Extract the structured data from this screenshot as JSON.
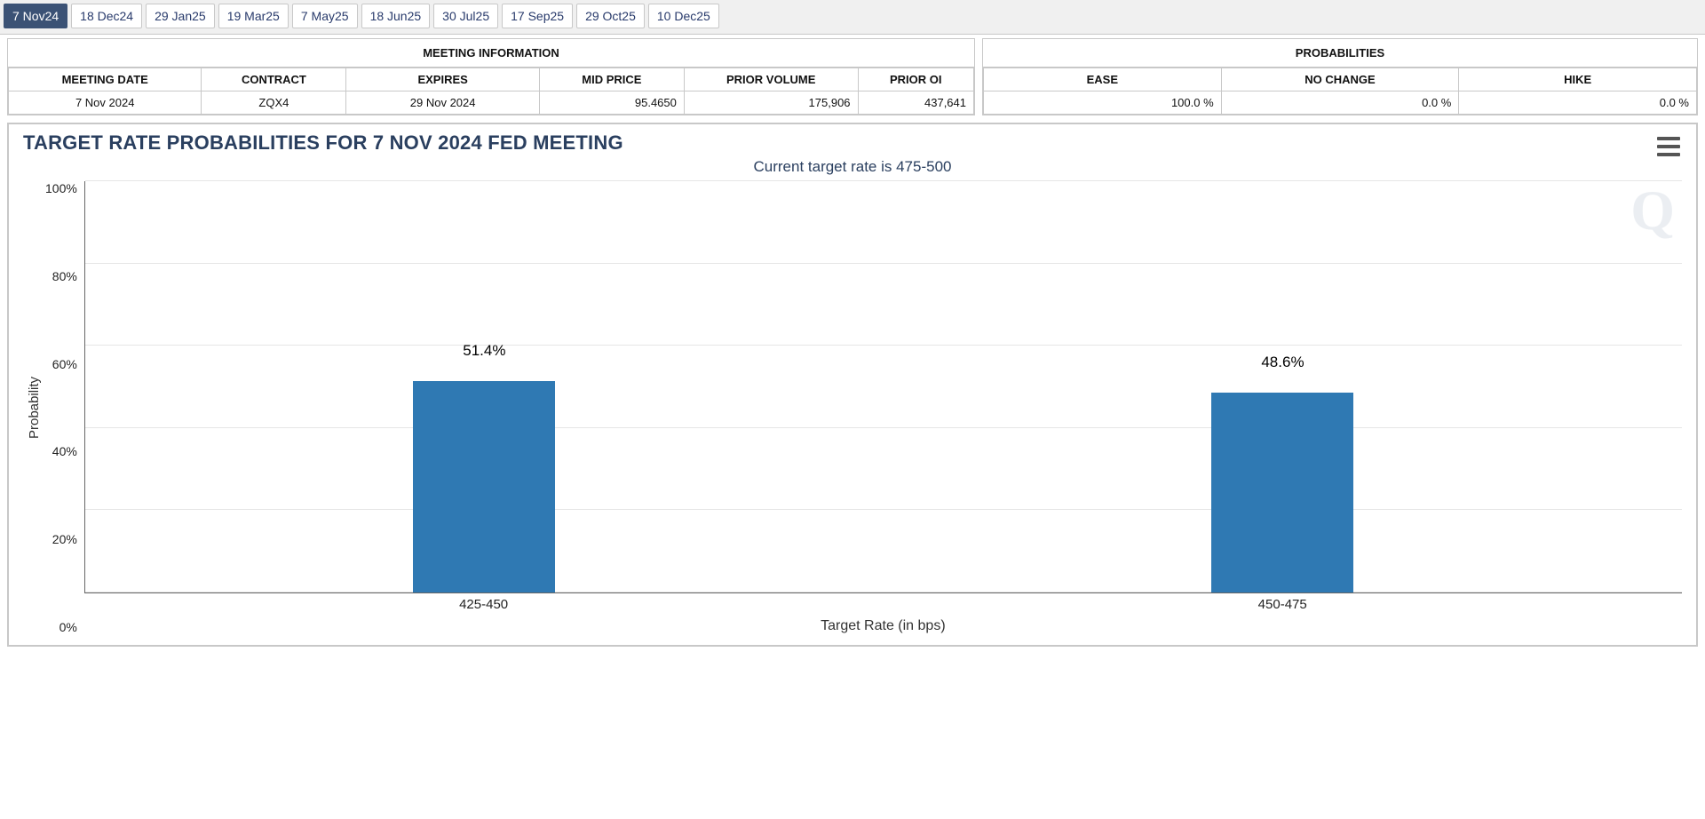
{
  "tabs": [
    "7 Nov24",
    "18 Dec24",
    "29 Jan25",
    "19 Mar25",
    "7 May25",
    "18 Jun25",
    "30 Jul25",
    "17 Sep25",
    "29 Oct25",
    "10 Dec25"
  ],
  "selected_tab_index": 0,
  "meeting_info": {
    "title": "MEETING INFORMATION",
    "headers": [
      "MEETING DATE",
      "CONTRACT",
      "EXPIRES",
      "MID PRICE",
      "PRIOR VOLUME",
      "PRIOR OI"
    ],
    "row": {
      "meeting_date": "7 Nov 2024",
      "contract": "ZQX4",
      "expires": "29 Nov 2024",
      "mid_price": "95.4650",
      "prior_volume": "175,906",
      "prior_oi": "437,641"
    }
  },
  "probabilities_panel": {
    "title": "PROBABILITIES",
    "headers": [
      "EASE",
      "NO CHANGE",
      "HIKE"
    ],
    "row": {
      "ease": "100.0 %",
      "no_change": "0.0 %",
      "hike": "0.0 %"
    }
  },
  "chart_title": "TARGET RATE PROBABILITIES FOR 7 NOV 2024 FED MEETING",
  "chart_subtitle": "Current target rate is 475-500",
  "chart_data": {
    "type": "bar",
    "title": "TARGET RATE PROBABILITIES FOR 7 NOV 2024 FED MEETING",
    "subtitle": "Current target rate is 475-500",
    "xlabel": "Target Rate (in bps)",
    "ylabel": "Probability",
    "categories": [
      "425-450",
      "450-475"
    ],
    "values": [
      51.4,
      48.6
    ],
    "value_labels": [
      "51.4%",
      "48.6%"
    ],
    "ylim": [
      0,
      100
    ],
    "yticks": [
      0,
      20,
      40,
      60,
      80,
      100
    ],
    "ytick_labels": [
      "0%",
      "20%",
      "40%",
      "60%",
      "80%",
      "100%"
    ]
  }
}
